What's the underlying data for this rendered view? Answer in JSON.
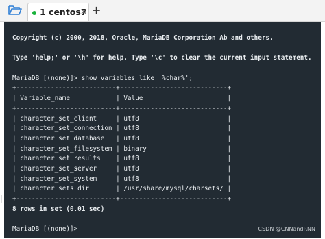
{
  "tabbar": {
    "folder_icon": "folder-open-icon",
    "tab_label": "1 centos7",
    "tab_status_color": "#19b23b",
    "close_glyph": "✕",
    "add_glyph": "+"
  },
  "terminal": {
    "background": "#222b33",
    "lines": [
      "Copyright (c) 2000, 2018, Oracle, MariaDB Corporation Ab and others.",
      "",
      "Type 'help;' or '\\h' for help. Type '\\c' to clear the current input statement.",
      "",
      "MariaDB [(none)]> show variables like '%char%';",
      "+--------------------------+----------------------------+",
      "| Variable_name            | Value                      |",
      "+--------------------------+----------------------------+",
      "| character_set_client     | utf8                       |",
      "| character_set_connection | utf8                       |",
      "| character_set_database   | utf8                       |",
      "| character_set_filesystem | binary                     |",
      "| character_set_results    | utf8                       |",
      "| character_set_server     | utf8                       |",
      "| character_set_system     | utf8                       |",
      "| character_sets_dir       | /usr/share/mysql/charsets/ |",
      "+--------------------------+----------------------------+",
      "8 rows in set (0.01 sec)",
      "",
      "MariaDB [(none)]>"
    ]
  },
  "watermark": "CSDN @CNNandRNN"
}
